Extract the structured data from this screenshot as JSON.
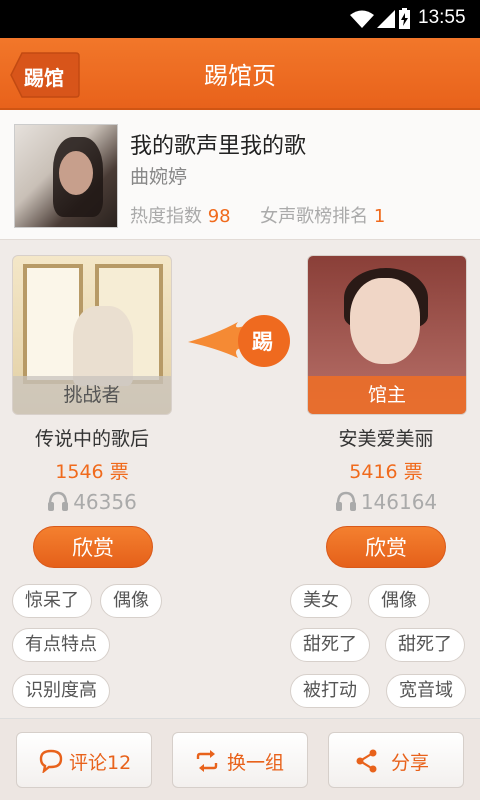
{
  "statusbar": {
    "time": "13:55"
  },
  "header": {
    "back_label": "踢馆",
    "title": "踢馆页"
  },
  "song": {
    "name": "我的歌声里我的歌",
    "singer": "曲婉婷",
    "heat_label": "热度指数",
    "heat_value": "98",
    "rank_label": "女声歌榜排名",
    "rank_value": "1"
  },
  "kick_label": "踢",
  "challenger": {
    "role": "挑战者",
    "name": "传说中的歌后",
    "votes": "1546 票",
    "listens": "46356",
    "button": "欣赏",
    "tags": [
      "惊呆了",
      "偶像",
      "有点特点",
      "识别度高"
    ]
  },
  "owner": {
    "role": "馆主",
    "name": "安美爱美丽",
    "votes": "5416 票",
    "listens": "146164",
    "button": "欣赏",
    "tags": [
      "美女",
      "偶像",
      "甜死了",
      "甜死了",
      "被打动",
      "宽音域"
    ]
  },
  "bottom": {
    "comment": "评论12",
    "shuffle": "换一组",
    "share": "分享"
  },
  "colors": {
    "accent": "#e8621b",
    "votes": "#f06a1c"
  },
  "icons": [
    "wifi-icon",
    "signal-icon",
    "battery-icon",
    "headphones-icon",
    "comment-icon",
    "refresh-icon",
    "share-icon"
  ]
}
